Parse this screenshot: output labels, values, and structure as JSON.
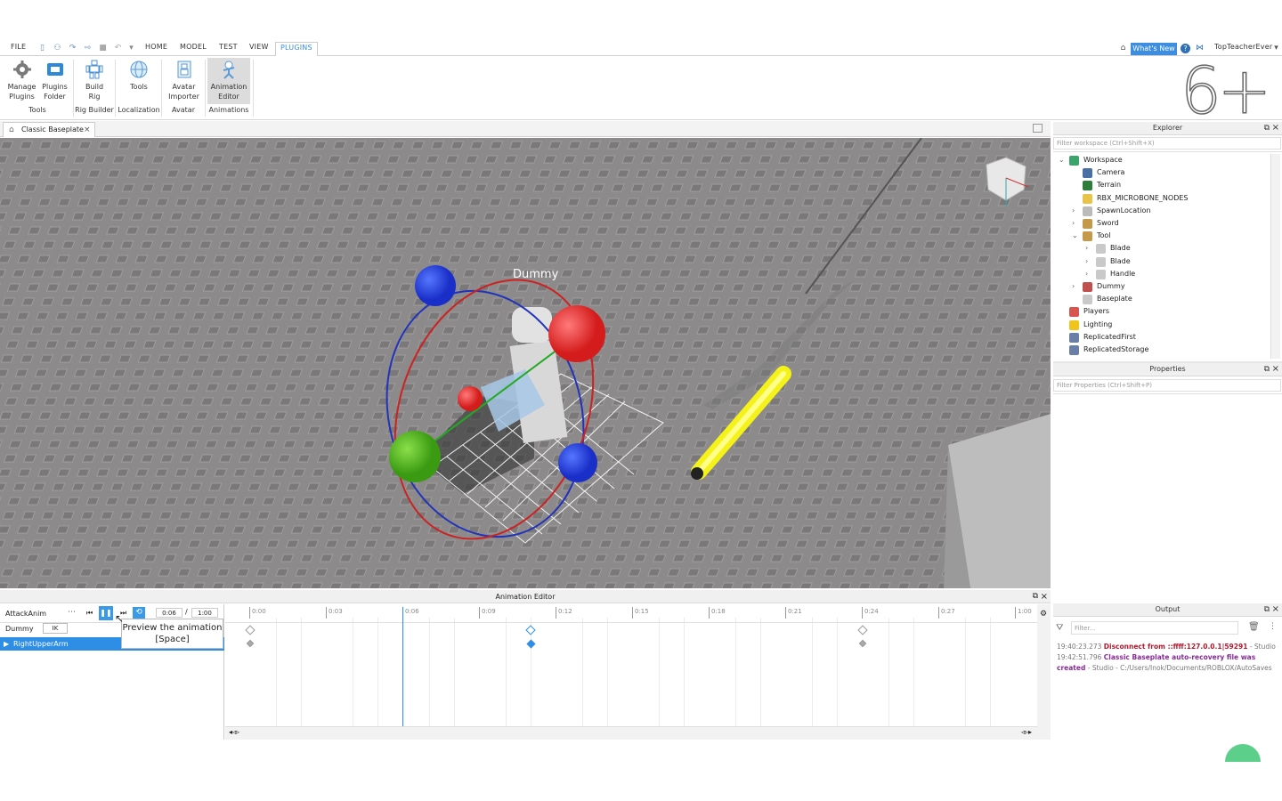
{
  "menubar": {
    "tabs": [
      "FILE",
      "HOME",
      "MODEL",
      "TEST",
      "VIEW",
      "PLUGINS"
    ],
    "active_tab": "PLUGINS",
    "whats_new": "What's New",
    "username": "TopTeacherEver"
  },
  "ribbon": {
    "buttons": [
      {
        "label": "Manage\nPlugins",
        "icon": "gear-icon"
      },
      {
        "label": "Plugins\nFolder",
        "icon": "folder-icon"
      },
      {
        "label": "Build\nRig",
        "icon": "rig-icon"
      },
      {
        "label": "Tools",
        "icon": "globe-icon"
      },
      {
        "label": "Avatar\nImporter",
        "icon": "avatar-icon"
      },
      {
        "label": "Animation\nEditor",
        "icon": "animation-icon"
      }
    ],
    "groups": [
      "Tools",
      "Rig Builder",
      "Localization",
      "Avatar",
      "Animations"
    ],
    "watermark": "6+"
  },
  "doc_tab": {
    "label": "Classic Baseplate"
  },
  "viewport": {
    "character_label": "Dummy"
  },
  "explorer": {
    "title": "Explorer",
    "filter_placeholder": "Filter workspace (Ctrl+Shift+X)",
    "items": [
      {
        "label": "Workspace",
        "depth": 0,
        "expanded": true,
        "color": "#3aa56a"
      },
      {
        "label": "Camera",
        "depth": 1,
        "color": "#4a6fa5"
      },
      {
        "label": "Terrain",
        "depth": 1,
        "color": "#2f7d3a"
      },
      {
        "label": "RBX_MICROBONE_NODES",
        "depth": 1,
        "color": "#e8c34a"
      },
      {
        "label": "SpawnLocation",
        "depth": 1,
        "collapsed": true,
        "color": "#bbbbbb"
      },
      {
        "label": "Sword",
        "depth": 1,
        "collapsed": true,
        "color": "#c49a4a"
      },
      {
        "label": "Tool",
        "depth": 1,
        "expanded": true,
        "color": "#c49a4a"
      },
      {
        "label": "Blade",
        "depth": 2,
        "collapsed": true,
        "color": "#c9c9c9"
      },
      {
        "label": "Blade",
        "depth": 2,
        "collapsed": true,
        "color": "#c9c9c9"
      },
      {
        "label": "Handle",
        "depth": 2,
        "collapsed": true,
        "color": "#c9c9c9"
      },
      {
        "label": "Dummy",
        "depth": 1,
        "collapsed": true,
        "color": "#c0504d"
      },
      {
        "label": "Baseplate",
        "depth": 1,
        "color": "#c9c9c9"
      },
      {
        "label": "Players",
        "depth": 0,
        "color": "#d9534f"
      },
      {
        "label": "Lighting",
        "depth": 0,
        "color": "#f0c419"
      },
      {
        "label": "ReplicatedFirst",
        "depth": 0,
        "color": "#6a7fa8"
      },
      {
        "label": "ReplicatedStorage",
        "depth": 0,
        "color": "#6a7fa8"
      }
    ]
  },
  "properties": {
    "title": "Properties",
    "filter_placeholder": "Filter Properties (Ctrl+Shift+P)"
  },
  "animation_editor": {
    "title": "Animation Editor",
    "animation_name": "AttackAnim",
    "rig_name": "Dummy",
    "ik_label": "IK",
    "current_time": "0:06",
    "end_time": "1:00",
    "tooltip": "Preview the animation\n[Space]",
    "track": "RightUpperArm",
    "ticks": [
      "0:00",
      "0:03",
      "0:06",
      "0:09",
      "0:12",
      "0:15",
      "0:18",
      "0:21",
      "0:24",
      "0:27",
      "1:00"
    ],
    "playhead_time": "0:06",
    "keyframe_times": [
      "0:00",
      "0:11",
      "0:24"
    ]
  },
  "output": {
    "title": "Output",
    "filter_placeholder": "Filter...",
    "lines": [
      {
        "time": "19:40:23.273",
        "message": "Disconnect from ::ffff:127.0.0.1|59291",
        "source": " - Studio",
        "color": "#b5172c"
      },
      {
        "time": "19:42:51.796",
        "message": "Classic Baseplate auto-recovery file was created",
        "source": " - Studio - C:/Users/Inok/Documents/ROBLOX/AutoSaves",
        "color": "#8a2a9a"
      }
    ]
  }
}
